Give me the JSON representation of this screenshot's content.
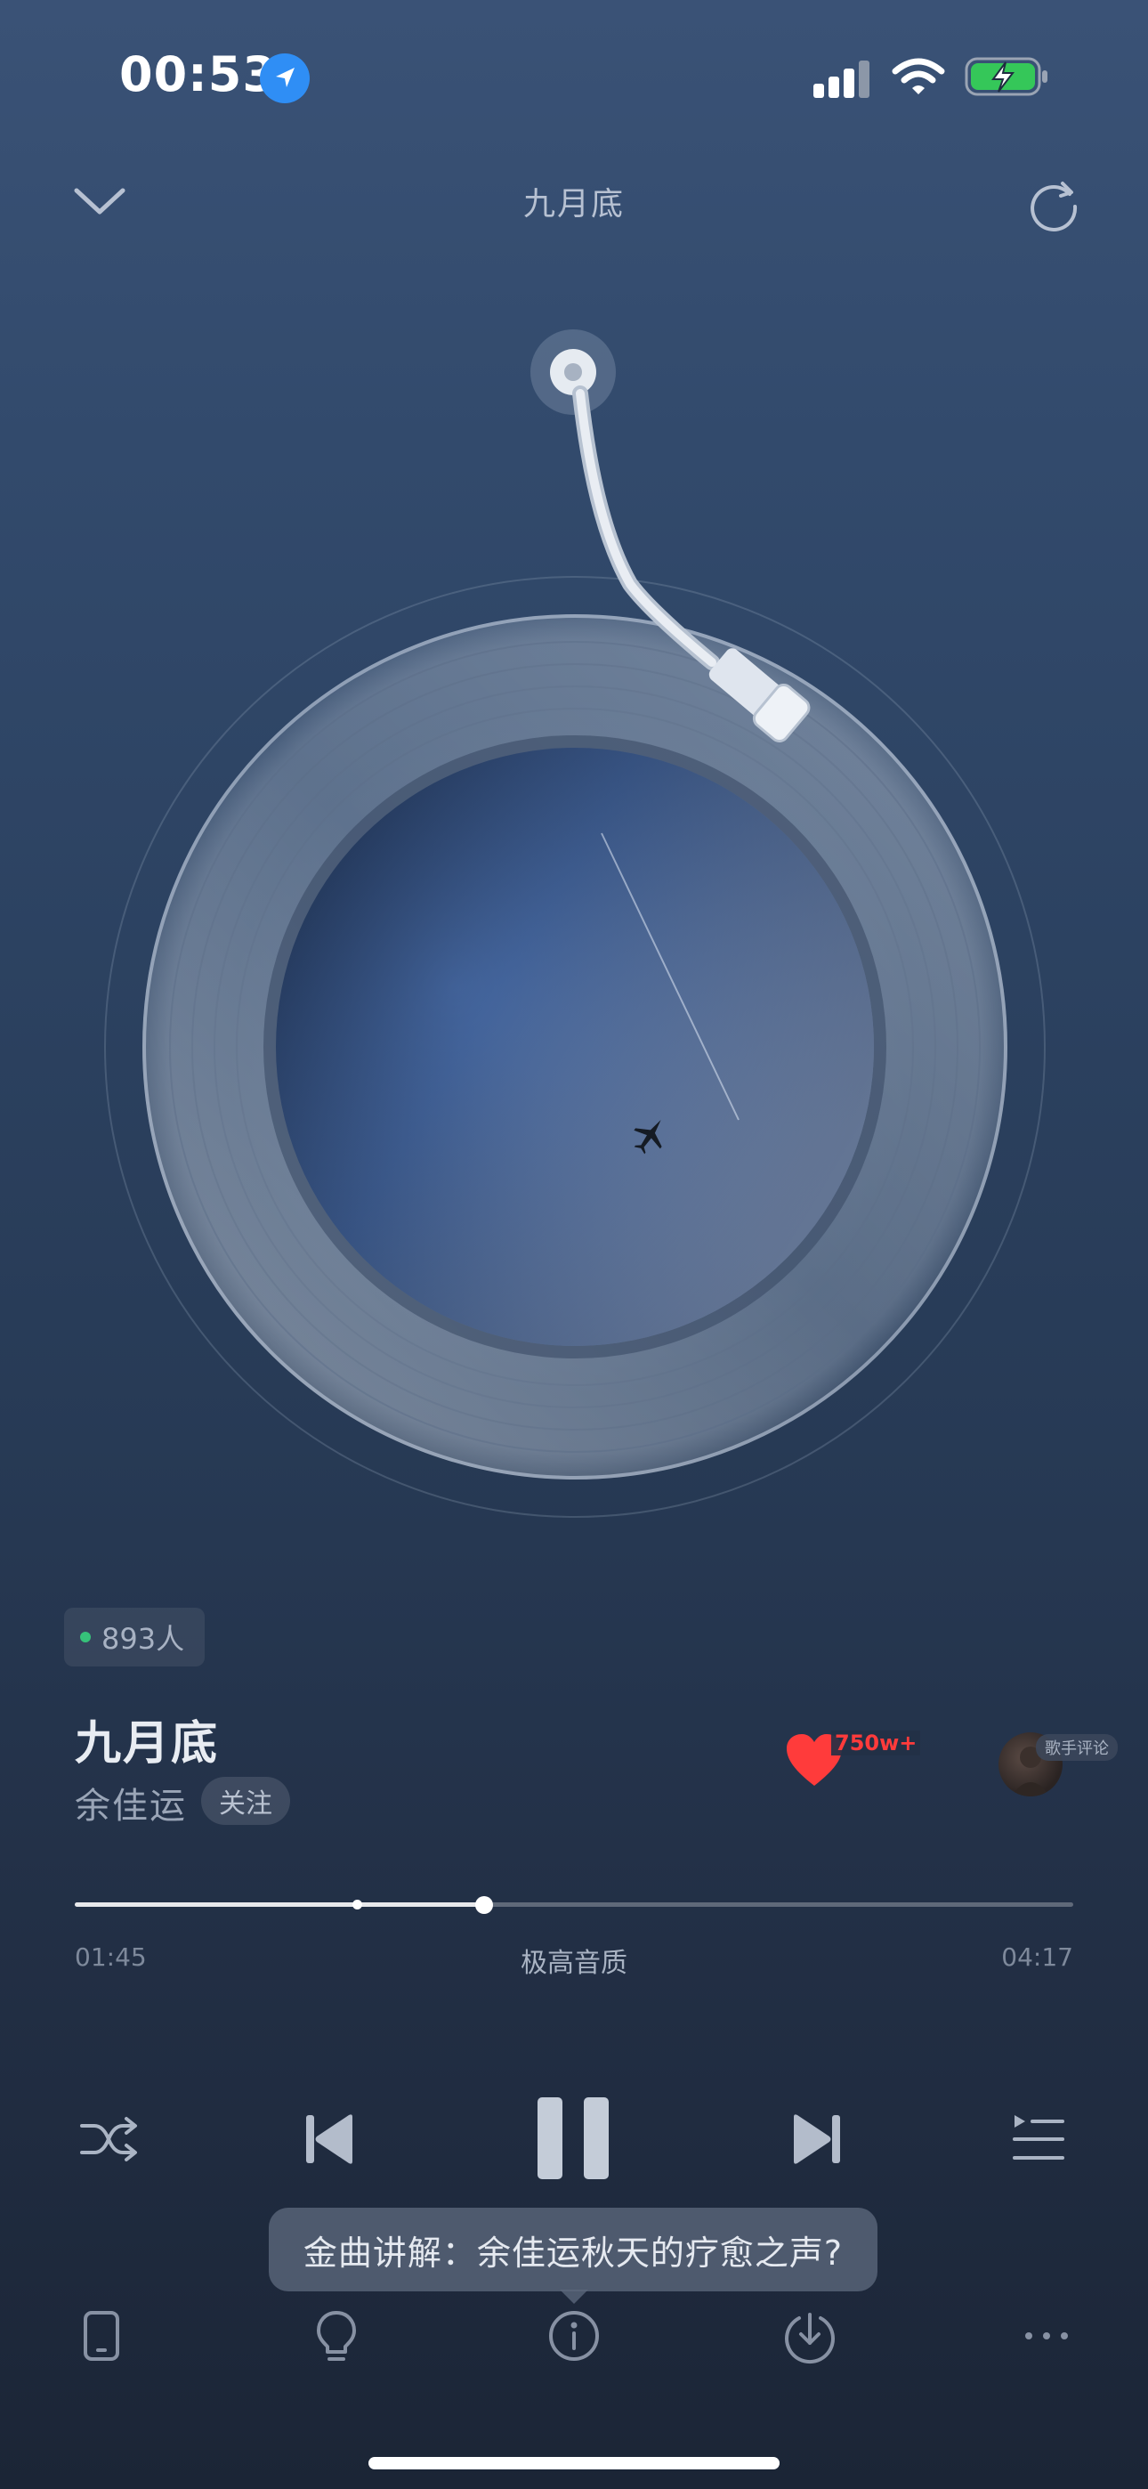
{
  "status_bar": {
    "time": "00:53",
    "icons": [
      "location-arrow-icon",
      "signal-icon",
      "wifi-icon",
      "battery-charging-icon"
    ]
  },
  "header": {
    "title": "九月底",
    "left_icon": "chevron-down-icon",
    "right_icon": "share-refresh-icon"
  },
  "listeners": {
    "count_label": "893人",
    "dot_color": "#36c27a"
  },
  "song": {
    "title": "九月底",
    "artist": "余佳运",
    "follow_label": "关注"
  },
  "like": {
    "count": "750w+",
    "color": "#ff3b3b"
  },
  "singer_comment": {
    "label": "歌手评论"
  },
  "progress": {
    "current": "01:45",
    "total": "04:17",
    "quality": "极高音质",
    "played_fraction": 0.41
  },
  "controls": {
    "icons": [
      "shuffle-icon",
      "previous-icon",
      "pause-icon",
      "next-icon",
      "playlist-icon"
    ]
  },
  "tooltip": {
    "text": "金曲讲解：余佳运秋天的疗愈之声?"
  },
  "bottom_bar": {
    "icons": [
      "device-icon",
      "lightbulb-icon",
      "info-icon",
      "download-icon",
      "more-icon"
    ]
  }
}
